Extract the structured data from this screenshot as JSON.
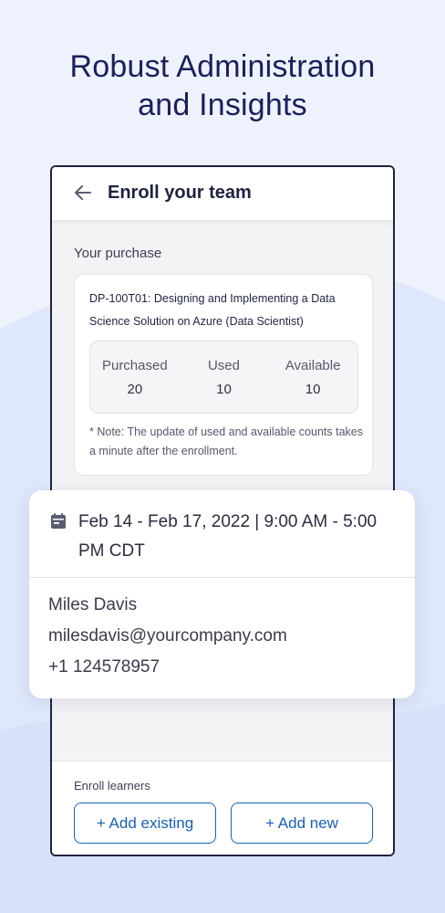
{
  "headline": {
    "line1": "Robust Administration",
    "line2": "and Insights"
  },
  "header": {
    "back_icon": "arrow-left-icon",
    "title": "Enroll your team"
  },
  "purchase": {
    "section_label": "Your purchase",
    "course_title": "DP-100T01: Designing and Implementing a Data Science Solution on Azure (Data Scientist)",
    "stats": [
      {
        "label": "Purchased",
        "value": "20"
      },
      {
        "label": "Used",
        "value": "10"
      },
      {
        "label": "Available",
        "value": "10"
      }
    ],
    "note": "* Note: The update of used and available counts takes a minute after the enrollment."
  },
  "event": {
    "icon": "calendar-icon",
    "date_time": "Feb 14 - Feb 17, 2022 | 9:00 AM - 5:00 PM CDT",
    "attendee_name": "Miles Davis",
    "attendee_email": "milesdavis@yourcompany.com",
    "attendee_phone": "+1 124578957"
  },
  "enroll": {
    "label": "Enroll learners",
    "add_existing": "+ Add existing",
    "add_new": "+ Add new"
  },
  "colors": {
    "background": "#eef2fd",
    "wave": "#dde6fb",
    "headline": "#1c1f5a",
    "accent": "#1a63b8"
  }
}
